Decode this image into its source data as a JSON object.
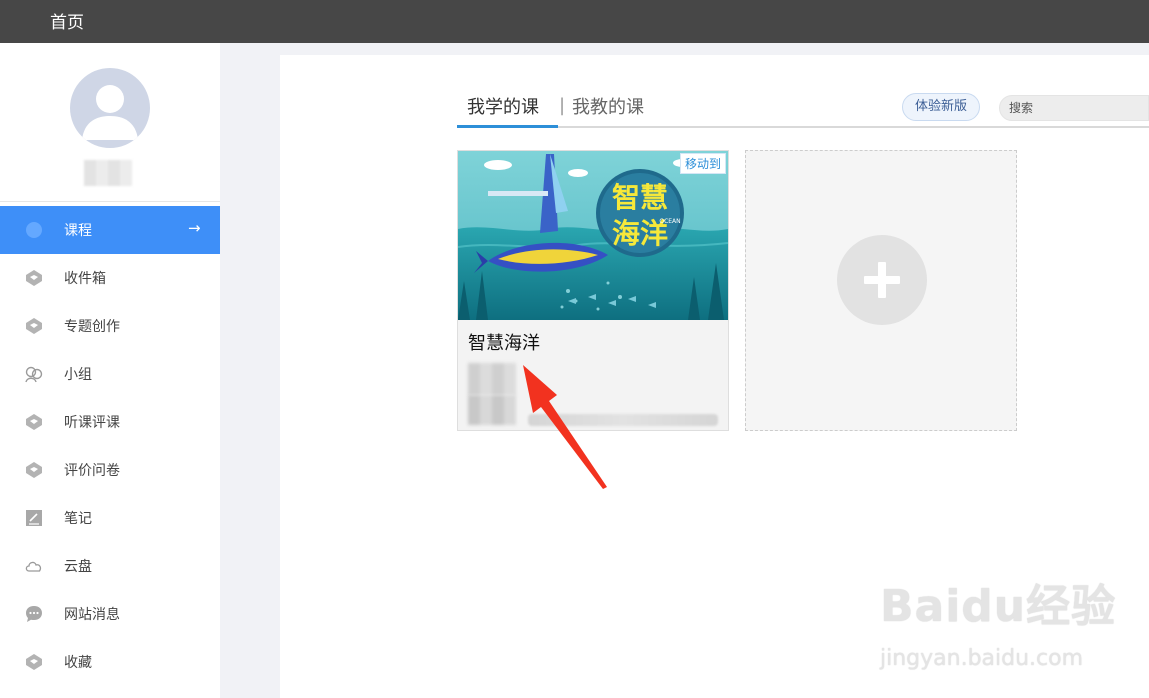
{
  "topbar": {
    "home_label": "首页"
  },
  "sidebar": {
    "items": [
      {
        "label": "课程",
        "icon": "course-icon",
        "active": true
      },
      {
        "label": "收件箱",
        "icon": "inbox-icon",
        "active": false
      },
      {
        "label": "专题创作",
        "icon": "topic-icon",
        "active": false
      },
      {
        "label": "小组",
        "icon": "group-icon",
        "active": false
      },
      {
        "label": "听课评课",
        "icon": "lecture-icon",
        "active": false
      },
      {
        "label": "评价问卷",
        "icon": "survey-icon",
        "active": false
      },
      {
        "label": "笔记",
        "icon": "note-icon",
        "active": false
      },
      {
        "label": "云盘",
        "icon": "cloud-icon",
        "active": false
      },
      {
        "label": "网站消息",
        "icon": "message-icon",
        "active": false
      },
      {
        "label": "收藏",
        "icon": "favorite-icon",
        "active": false
      }
    ],
    "active_arrow": "→"
  },
  "main": {
    "tabs": [
      {
        "label": "我学的课",
        "active": true
      },
      {
        "label": "我教的课",
        "active": false
      }
    ],
    "tab_separator": "|",
    "try_new_label": "体验新版",
    "search_placeholder": "搜索",
    "course": {
      "title": "智慧海洋",
      "move_label": "移动到",
      "cover_title": "智慧海洋",
      "cover_subtitle": "OCEAN"
    }
  },
  "watermark": {
    "brand": "Baidu经验",
    "url": "jingyan.baidu.com"
  },
  "colors": {
    "active_blue": "#3e8ff8",
    "topbar": "#474747",
    "tab_underline": "#2d8fd8",
    "arrow_red": "#f2321f"
  }
}
